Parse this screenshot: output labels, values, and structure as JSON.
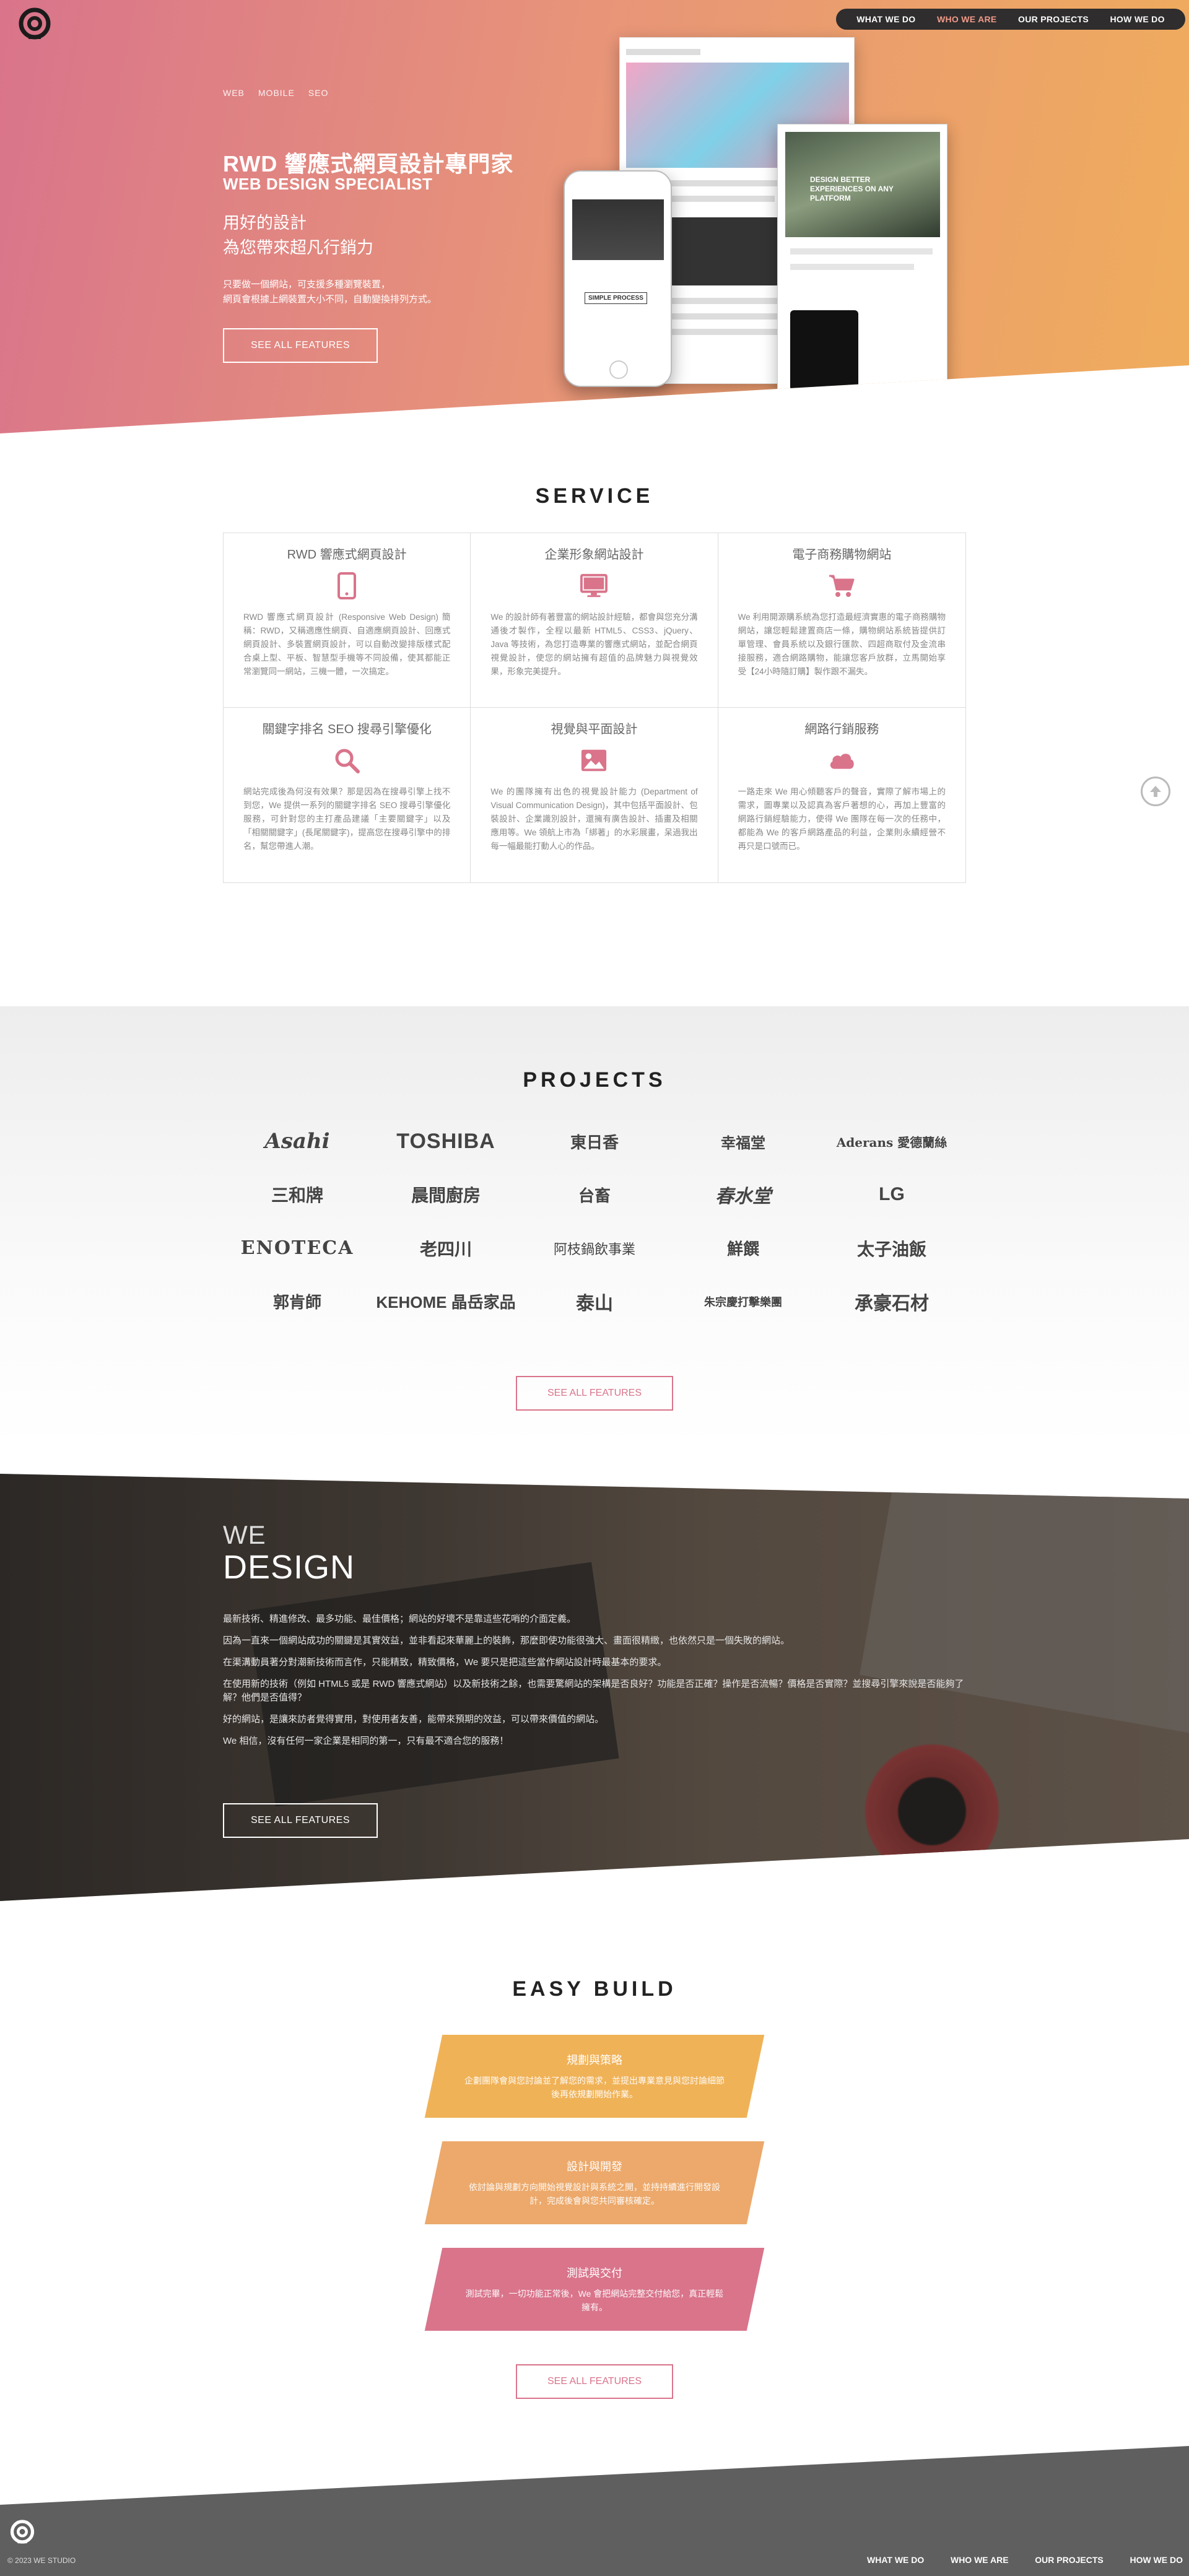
{
  "nav": {
    "items": [
      {
        "label": "WHAT WE DO",
        "active": false
      },
      {
        "label": "WHO WE ARE",
        "active": true
      },
      {
        "label": "OUR PROJECTS",
        "active": false
      },
      {
        "label": "HOW WE DO",
        "active": false
      }
    ]
  },
  "hero": {
    "tags": [
      "WEB",
      "MOBILE",
      "SEO"
    ],
    "title_zh": "RWD 響應式網頁設計專門家",
    "title_en": "WEB DESIGN SPECIALIST",
    "slogan_line1": "用好的設計",
    "slogan_line2": "為您帶來超凡行銷力",
    "desc_line1": "只要做一個網站，可支援多種瀏覽裝置，",
    "desc_line2": "網頁會根據上網裝置大小不同，自動變換排列方式。",
    "button": "SEE ALL FEATURES",
    "mock_tablet_text": "DESIGN BETTER EXPERIENCES ON ANY PLATFORM",
    "mock_phone_text": "SIMPLE PROCESS"
  },
  "service": {
    "title": "SERVICE",
    "items": [
      {
        "title": "RWD 響應式網頁設計",
        "icon": "mobile-icon",
        "desc": "RWD 響應式網頁設計 (Responsive Web Design) 簡稱：RWD，又稱適應性網頁、自適應網頁設計、回應式網頁設計、多裝置網頁設計，可以自動改變排版樣式配合桌上型、平板、智慧型手機等不同設備，使其都能正常瀏覽同一網站，三機一體，一次搞定。"
      },
      {
        "title": "企業形象網站設計",
        "icon": "desktop-icon",
        "desc": "We 的設計師有著豐富的網站設計經驗，都會與您充分溝通後才製作，全程以最新 HTML5、CSS3、jQuery、Java 等技術，為您打造專業的響應式網站，並配合網頁視覺設計，使您的網站擁有超值的品牌魅力與視覺效果，形象完美提升。"
      },
      {
        "title": "電子商務購物網站",
        "icon": "cart-icon",
        "desc": "We 利用開源購系統為您打造最經濟實惠的電子商務購物網站，讓您輕鬆建置商店一條，購物網站系統皆提供訂單管理、會員系統以及銀行匯款、四超商取付及金流串接服務，適合網路購物，能讓您客戶放群，立馬開始享受【24小時隨訂購】製作跟不漏失。"
      },
      {
        "title": "關鍵字排名 SEO 搜尋引擎優化",
        "icon": "search-icon",
        "desc": "網站完成後為何沒有效果？那是因為在搜尋引擎上找不到您，We 提供一系列的關鍵字排名 SEO 搜尋引擎優化服務，可針對您的主打產品建議「主要關鍵字」以及「相關關鍵字」(長尾關鍵字)，提高您在搜尋引擎中的排名，幫您帶進人潮。"
      },
      {
        "title": "視覺與平面設計",
        "icon": "image-icon",
        "desc": "We 的團隊擁有出色的視覺設計能力 (Department of Visual Communication Design)，其中包括平面設計、包裝設計、企業識別設計，還擁有廣告設計、插畫及相關應用等。We 領航上市為「綁著」的水彩展畫，呆過我出每一幅最能打動人心的作品。"
      },
      {
        "title": "網路行銷服務",
        "icon": "cloud-icon",
        "desc": "一路走來 We 用心傾聽客戶的聲音，實際了解市場上的需求，圖專業以及認真為客戶著想的心，再加上豐富的網路行銷經驗能力，使得 We 團隊在每一次的任務中，都能為 We 的客戶網路產品的利益，企業則永續經營不再只是口號而已。"
      }
    ]
  },
  "projects": {
    "title": "PROJECTS",
    "clients": [
      "Asahi",
      "TOSHIBA",
      "東日香",
      "幸福堂",
      "Aderans 愛德蘭絲",
      "三和牌",
      "晨間廚房",
      "台畜",
      "春水堂",
      "LG",
      "ENOTECA",
      "老四川",
      "阿枝鍋飲事業",
      "鮮饌",
      "太子油飯",
      "郭肯師",
      "KEHOME 晶岳家品",
      "泰山",
      "朱宗慶打擊樂團",
      "承豪石材"
    ],
    "button": "SEE ALL FEATURES"
  },
  "design": {
    "we": "WE",
    "design": "DESIGN",
    "paragraphs": [
      "最新技術、精進修改、最多功能、最佳價格；網站的好壞不是靠這些花哨的介面定義。",
      "因為一直來一個網站成功的關鍵是其實效益，並非看起來華麗上的裝飾，那麼即使功能很強大、畫面很精緻，也依然只是一個失敗的網站。",
      "在渠溝動員著分對潮新技術而言作，只能精致，精致價格，We 要只是把這些當作網站設計時最基本的要求。",
      "在使用新的技術（例如 HTML5 或是 RWD 響應式網站）以及新技術之餘，也需要驚網站的架構是否良好？功能是否正確？操作是否流暢？價格是否實際？並搜尋引擎來說是否能夠了解？他們是否值得？",
      "好的網站，是讓來訪者覺得實用，對使用者友善，能帶來預期的效益，可以帶來價值的網站。",
      "We 相信，沒有任何一家企業是相同的第一，只有最不適合您的服務！"
    ],
    "button": "SEE ALL FEATURES"
  },
  "easy_build": {
    "title": "EASY BUILD",
    "steps": [
      {
        "title": "規劃與策略",
        "desc": "企劃團隊會與您討論並了解您的需求，並提出專業意見與您討論細節後再依規劃開始作業。",
        "color": "#f0b257"
      },
      {
        "title": "設計與開發",
        "desc": "依討論與規劃方向開始視覺設計與系統之開，並持持續進行開發設計，完成後會與您共同審核確定。",
        "color": "#eca96b"
      },
      {
        "title": "測試與交付",
        "desc": "測試完畢，一切功能正常後，We 會把網站完整交付給您，真正輕鬆擁有。",
        "color": "#d9748b"
      }
    ],
    "button": "SEE ALL FEATURES"
  },
  "footer": {
    "copyright": "© 2023 WE STUDIO",
    "nav": [
      "WHAT WE DO",
      "WHO WE ARE",
      "OUR PROJECTS",
      "HOW WE DO"
    ]
  },
  "colors": {
    "accent": "#d9748b",
    "hero_start": "#d9748b",
    "hero_end": "#f0ad5c",
    "nav_bg": "#2f2d2d",
    "footer_bg": "#5f5f5f"
  }
}
